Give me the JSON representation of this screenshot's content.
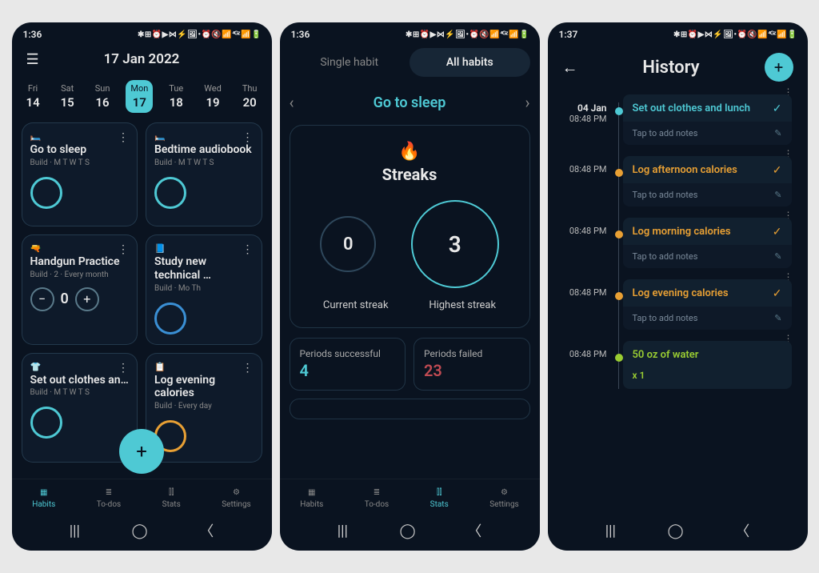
{
  "statusbar": {
    "time_s1": "1:36",
    "time_s2": "1:36",
    "time_s3": "1:37",
    "icons": "✱ ⊞ ⏰ ▶ ⋈ ⚡ 🖼  •  ⏰ 🔇 📶 ⁴ᴳᶻ 📶 🔋"
  },
  "screen1": {
    "date_title": "17 Jan 2022",
    "calendar": [
      {
        "dow": "Fri",
        "num": "14"
      },
      {
        "dow": "Sat",
        "num": "15"
      },
      {
        "dow": "Sun",
        "num": "16"
      },
      {
        "dow": "Mon",
        "num": "17",
        "selected": true
      },
      {
        "dow": "Tue",
        "num": "18"
      },
      {
        "dow": "Wed",
        "num": "19"
      },
      {
        "dow": "Thu",
        "num": "20"
      }
    ],
    "habits": [
      {
        "emoji": "🛏️",
        "title": "Go to sleep",
        "sub": "Build · M T W T S",
        "ring": "#4ec9d4"
      },
      {
        "emoji": "🛏️",
        "title": "Bedtime audiobook",
        "sub": "Build · M T W T S",
        "ring": "#4ec9d4"
      },
      {
        "emoji": "🔫",
        "title": "Handgun Practice",
        "sub": "Build · 2 · Every month",
        "counter": "0"
      },
      {
        "emoji": "📘",
        "title": "Study new technical …",
        "sub": "Build · Mo Th",
        "ring": "#3a8fd4"
      },
      {
        "emoji": "👕",
        "title": "Set out clothes an…",
        "sub": "Build · M T W T S",
        "ring": "#4ec9d4"
      },
      {
        "emoji": "📋",
        "title": "Log evening calories",
        "sub": "Build · Every day",
        "ring": "#e8a034"
      }
    ]
  },
  "screen2": {
    "tab1": "Single habit",
    "tab2": "All habits",
    "habit_name": "Go to sleep",
    "streaks_label": "Streaks",
    "current_val": "0",
    "highest_val": "3",
    "current_label": "Current streak",
    "highest_label": "Highest streak",
    "success_label": "Periods successful",
    "success_val": "4",
    "failed_label": "Periods failed",
    "failed_val": "23"
  },
  "screen3": {
    "title": "History",
    "date": "04 Jan",
    "notes_placeholder": "Tap to add notes",
    "entries": [
      {
        "time": "08:48 PM",
        "name": "Set out clothes and lunch",
        "color": "#4ec9d4",
        "dot": "#4ec9d4",
        "date_label": "04 Jan"
      },
      {
        "time": "08:48 PM",
        "name": "Log afternoon calories",
        "color": "#e8a034",
        "dot": "#e8a034"
      },
      {
        "time": "08:48 PM",
        "name": "Log morning calories",
        "color": "#e8a034",
        "dot": "#e8a034"
      },
      {
        "time": "08:48 PM",
        "name": "Log evening calories",
        "color": "#e8a034",
        "dot": "#e8a034"
      },
      {
        "time": "08:48 PM",
        "name": "50 oz of water",
        "sub": "x 1",
        "color": "#9acd32",
        "dot": "#9acd32",
        "no_notes": true
      }
    ]
  },
  "bottomnav": {
    "habits": "Habits",
    "todos": "To-dos",
    "stats": "Stats",
    "settings": "Settings"
  }
}
